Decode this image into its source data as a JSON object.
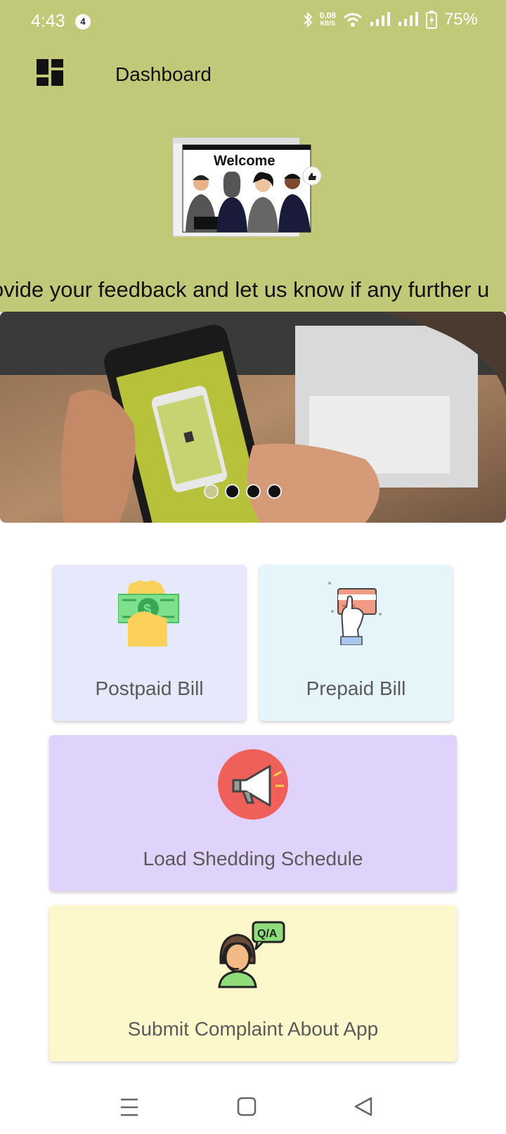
{
  "status_bar": {
    "time": "4:43",
    "notification_count": "4",
    "net_speed_value": "0.08",
    "net_speed_unit": "KB/S",
    "battery": "75%"
  },
  "app_bar": {
    "title": "Dashboard",
    "menu_icon": "dashboard-grid-icon"
  },
  "welcome_illustration": {
    "heading": "Welcome"
  },
  "marquee": {
    "text": "ovide your feedback and let us know if any further u"
  },
  "banner": {
    "slide_count": 4,
    "active_slide": 1
  },
  "cards": {
    "postpaid": {
      "label": "Postpaid Bill",
      "icon": "cash-hand-icon"
    },
    "prepaid": {
      "label": "Prepaid Bill",
      "icon": "card-hand-icon"
    },
    "load_shedding": {
      "label": "Load Shedding Schedule",
      "icon": "megaphone-icon"
    },
    "complaint": {
      "label": "Submit Complaint About App",
      "icon": "support-agent-icon",
      "badge": "Q/A"
    }
  },
  "colors": {
    "header_bg": "#c1c978",
    "postpaid_bg": "#e6e8fb",
    "prepaid_bg": "#e6f5fa",
    "load_bg": "#e0d3fb",
    "complaint_bg": "#fdf8cc"
  }
}
